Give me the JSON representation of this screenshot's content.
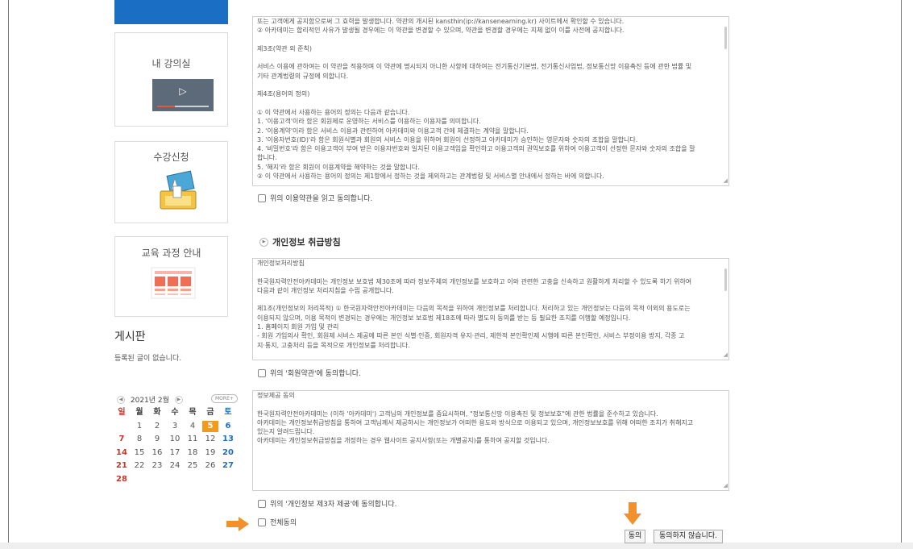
{
  "sidebar": {
    "classroom_title": "내 강의실",
    "enroll_title": "수강신청",
    "course_title": "교육 과정 안내",
    "board": {
      "title": "게시판",
      "empty_text": "등록된 글이 없습니다."
    },
    "calendar": {
      "prev": "◀",
      "month_label": "2021년 2월",
      "next": "▶",
      "more_label": "MORE+",
      "weekdays": [
        "일",
        "월",
        "화",
        "수",
        "목",
        "금",
        "토"
      ],
      "weeks": [
        [
          "",
          "1",
          "2",
          "3",
          "4",
          "5",
          "6"
        ],
        [
          "7",
          "8",
          "9",
          "10",
          "11",
          "12",
          "13"
        ],
        [
          "14",
          "15",
          "16",
          "17",
          "18",
          "19",
          "20"
        ],
        [
          "21",
          "22",
          "23",
          "24",
          "25",
          "26",
          "27"
        ],
        [
          "28",
          "",
          "",
          "",
          "",
          "",
          ""
        ]
      ],
      "today": "5"
    }
  },
  "colors": {
    "accent_blue": "#1a6fc4",
    "today_orange": "#f39a1b",
    "sunday_red": "#c0392b",
    "saturday_blue": "#1f6fbf"
  },
  "terms": {
    "lines": [
      "또는 고객에게 공지함으로써 그 효력을 발생합니다. 약관의 개시된 kansthin(ip://kansenearning.kr) 사이트에서 확인할 수 있습니다.",
      "② 아카데미는 합리적인 사유가 발생될 경우에는 이 약관을 변경할 수 있으며, 약관을 변경할 경우에는 지체 없이 이를 사전에 공지합니다.",
      "",
      "제3조(약관 외 준칙)",
      "",
      "서비스 이용에 관하여는 이 약관을 적용하며 이 약관에 명시되지 아니한 사항에 대하여는 전기통신기본법, 전기통신사업법, 정보통신망 이용촉진 등에 관한 법률 및",
      "기타 관계법령의 규정에 의합니다.",
      "",
      "제4조(용어의 정의)",
      "",
      "① 이 약관에서 사용하는 용어의 정의는 다음과 같습니다.",
      "1. '이용고객'이라 함은 회원제로 운영하는 서비스를 이용하는 이용자를 의미합니다.",
      "2. '이용계약'이라 함은 서비스 이용과 관련하여 아카데미와 이용고객 간에 체결하는 계약을 말합니다.",
      "3. '이용자번호(ID)'라 함은 회원식별과 회원의 서비스 이용을 위하여 회원이 선정하고 아카데미가 승인하는 영문자와 숫자의 조합을 말합니다.",
      "4. '비밀번호'라 함은 이용고객이 부여 받은 이용자번호와 일치된 이용고객임을 확인하고 이용고객의 권익보호를 위하여 이용고객이 선정한 문자와 숫자의 조합을 말",
      "합니다.",
      "5. '해지'라 함은 회원이 이용계약을 해약하는 것을 말합니다.",
      "② 이 약관에서 사용하는 용어의 정의는 제1항에서 정하는 것을 제외하고는 관계법령 및 서비스별 안내에서 정하는 바에 의합니다."
    ],
    "agree_label": "위의 이용약관을 읽고 동의합니다."
  },
  "privacy": {
    "section_title": "개인정보 취급방침",
    "lines": [
      "개인정보처리방침",
      "",
      "한국원자력안전아카데미는 개인정보 보호법 제30조에 따라 정보주체의 개인정보를 보호하고 이와 관련한 고충을 신속하고 원활하게 처리할 수 있도록 하기 위하여",
      "다음과 같이 개인정보 처리지침을 수립 공개합니다.",
      "",
      "제1조(개인정보의 처리목적) ① 한국원자력안전아카데미는 다음의 목적을 위하여 개인정보를 처리합니다. 처리하고 있는 개인정보는 다음의 목적 이외의 용도로는",
      "이용되지 않으며, 이용 목적이 변경되는 경우에는 개인정보 보호법 제18조에 따라 별도의 동의를 받는 등 필요한 조치를 이행할 예정입니다.",
      "  1. 홈페이지 회원 가입 및 관리",
      "  - 회원 가입의사 확인, 회원제 서비스 제공에 따른 본인 식별·인증, 회원자격 유지·관리, 제한적 본인확인제 시행에 따른 본인확인, 서비스 부정이용 방지, 각종 고",
      "지·통지, 고충처리 등을 목적으로 개인정보를 처리합니다."
    ],
    "agree_label": "위의 '회원약관'에 동의합니다."
  },
  "third_party": {
    "lines": [
      "정보제공 동의",
      "",
      "한국원자력안전아카데미는 (이하 '아카데미') 고객님의 개인정보를 중요시하며, \"정보통신망 이용촉진 및 정보보호\"에 관한 법률을 준수하고 있습니다.",
      "아카데미는 개인정보취급방침을 통하여 고객님께서 제공하시는 개인정보가 어떠한 용도와 방식으로 이용되고 있으며, 개인정보보호를 위해 어떠한 조치가 취해지고",
      "있는지 알려드립니다.",
      "아카데미는 개인정보취급방침을 개정하는 경우 웹사이트 공지사항(또는 개별공지)를 통하여 공지할 것입니다."
    ],
    "agree_label": "위의 '개인정보 제3자 제공'에 동의합니다."
  },
  "all_agree_label": "전체동의",
  "buttons": {
    "agree": "동의",
    "disagree": "동의하지 않습니다."
  }
}
